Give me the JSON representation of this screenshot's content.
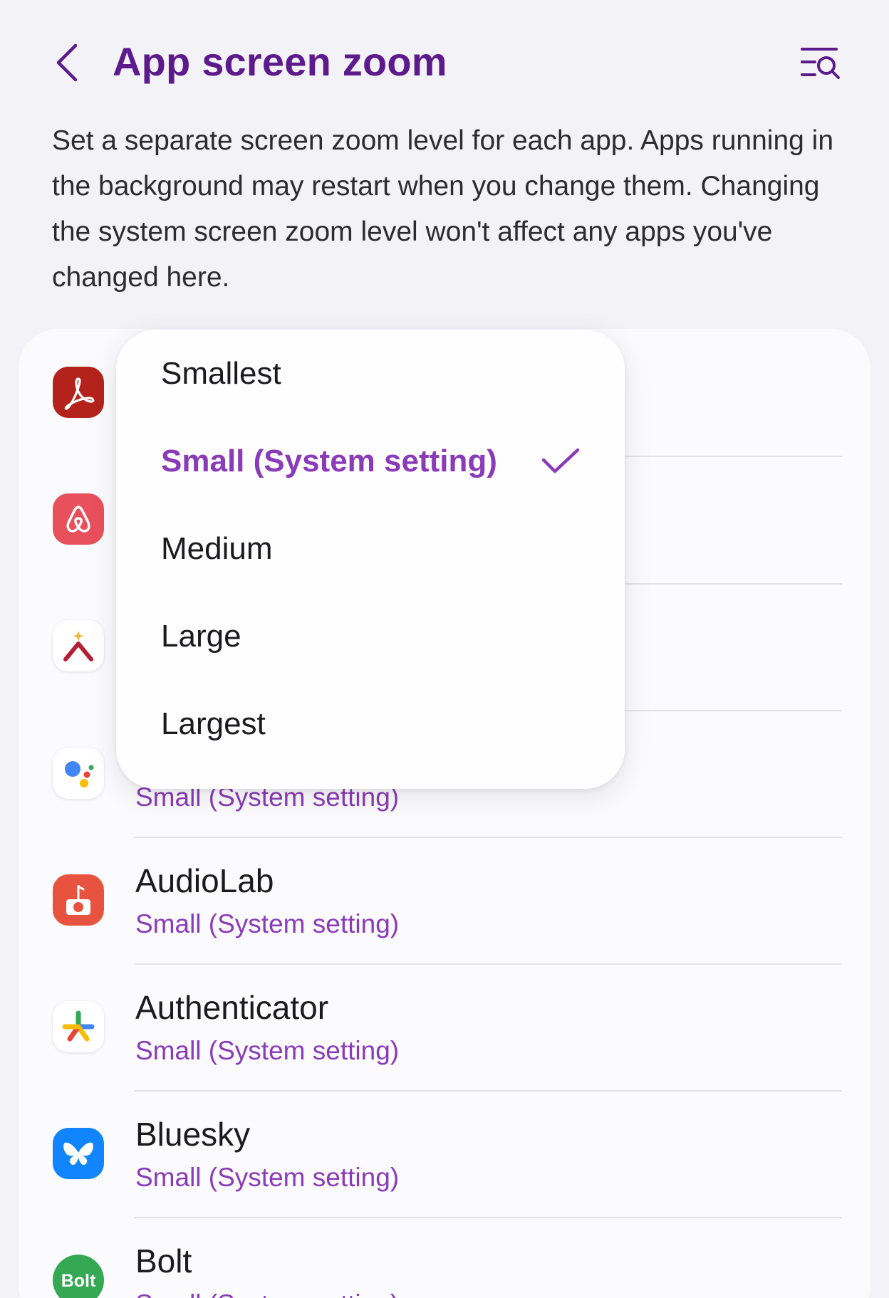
{
  "header": {
    "title": "App screen zoom",
    "accent_color": "#5d1a8c"
  },
  "description": "Set a separate screen zoom level for each app. Apps running in the background may restart when you change them. Changing the system screen zoom level won't affect any apps you've changed here.",
  "apps": [
    {
      "name": "",
      "value": "",
      "icon": "adobe-acrobat-icon"
    },
    {
      "name": "",
      "value": "",
      "icon": "airbnb-icon"
    },
    {
      "name": "",
      "value": "",
      "icon": "arc-icon"
    },
    {
      "name": "",
      "value": "Small (System setting)",
      "icon": "google-assistant-icon"
    },
    {
      "name": "AudioLab",
      "value": "Small (System setting)",
      "icon": "audiolab-icon"
    },
    {
      "name": "Authenticator",
      "value": "Small (System setting)",
      "icon": "authenticator-icon"
    },
    {
      "name": "Bluesky",
      "value": "Small (System setting)",
      "icon": "bluesky-icon"
    },
    {
      "name": "Bolt",
      "value": "Small (System setting)",
      "icon": "bolt-icon"
    }
  ],
  "zoom_menu": {
    "options": [
      "Smallest",
      "Small (System setting)",
      "Medium",
      "Large",
      "Largest"
    ],
    "selected": "Small (System setting)",
    "selected_color": "#8a3bb8"
  },
  "icons": {
    "back": "chevron-left-icon",
    "search": "search-list-icon",
    "selected": "checkmark-icon"
  }
}
